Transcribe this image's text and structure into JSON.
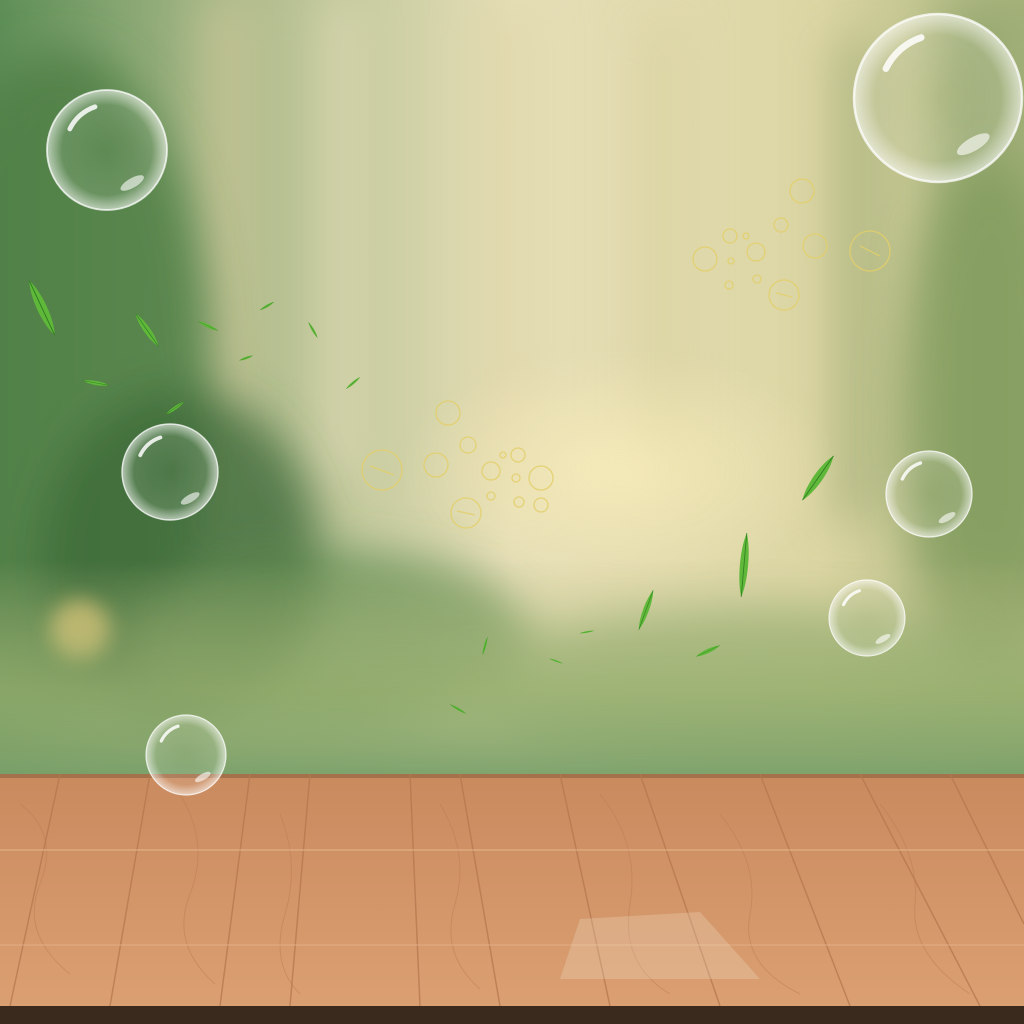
{
  "scene": {
    "colors": {
      "mist": "#efe6c2",
      "foliage": "#6f9657",
      "foliage_dark": "#3f6b3b",
      "glow": "#f3dca0",
      "wood_light": "#d99a6a",
      "wood_mid": "#c6855a",
      "wood_dark": "#a8683f",
      "floor_edge": "#3a2a1d",
      "leaf": "#5fb83a",
      "ring": "#e3cf6a"
    },
    "elements": [
      "blurred-forest-backdrop",
      "wooden-floor",
      "soap-bubbles",
      "falling-leaves",
      "ring-sparkles"
    ]
  }
}
